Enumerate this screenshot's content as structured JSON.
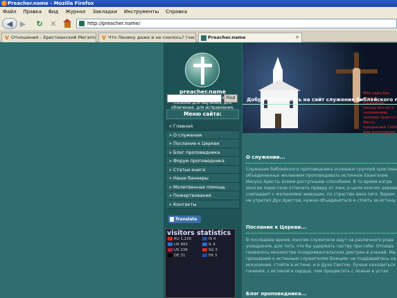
{
  "browser": {
    "title": "Preacher.name - Mozilla Firefox",
    "menu": [
      "Файл",
      "Правка",
      "Вид",
      "Журнал",
      "Закладки",
      "Инструменты",
      "Справка"
    ],
    "url": "http://preacher.name/",
    "tabs": [
      {
        "label": "Отношения - Христианский Мегапор...",
        "icon": "v-logo-icon"
      },
      {
        "label": "Что Ленину даже и не снилось? (час...",
        "icon": "v-logo-icon"
      },
      {
        "label": "Preacher.name",
        "icon": "site-icon",
        "active": true
      }
    ]
  },
  "site": {
    "name": "preacher.name",
    "motto": "Все Писание богодухновенно и полезно для научения, для обличения, для исправления, для наставления в праведности",
    "search_placeholder": "",
    "find_label": "Find",
    "menu_title": "Меню сайта:",
    "menu": [
      "« Главная",
      "» О служении",
      "» Послание к Церкви",
      "» Блог проповедника",
      "» Форум проповедника",
      "» Статьи книги",
      "» Наши баннеры",
      "» Молитвенная помощь",
      "» Пожертвования",
      "» Контакты"
    ],
    "translate_label": "Translate",
    "stats": {
      "title": "visitors statistics",
      "rows": [
        {
          "left": "RU 1,226",
          "left_color": "#d52b1e",
          "right": "IS 4",
          "right_color": "#1e4fa8"
        },
        {
          "left": "UA 882",
          "left_color": "#2b6fd5",
          "right": "IL 4",
          "right_color": "#2b6fd5"
        },
        {
          "left": "US 238",
          "left_color": "#b22234",
          "right": "SG 3",
          "right_color": "#d52b1e"
        },
        {
          "left": "DE 31",
          "left_color": "#000000",
          "right": "FR 3",
          "right_color": "#1e4fa8"
        }
      ]
    }
  },
  "banner": {
    "text": "Ибо един Бог, един и посредник между Богом и человеками, человек Христос Иисус, предавший Себя для искупления всех"
  },
  "main": {
    "welcome": "Добро пожаловать на сайт служения библейского проповедника",
    "sections": [
      {
        "title": "О служении...",
        "lines": [
          "Служение библейского проповедника основано группой христиан,",
          "объединенных желанием проповедовать истинное Евангелие",
          "Иисуса Христа, всеми доступными способами. В то время когда",
          "многие перестали отличать правду от лжи, и цели многих церквей",
          "совпадают с желаниями живущих, по страстям века сего. Верим,",
          "не утратил Дух Христов, нужно объединяться и стоять за истину."
        ]
      },
      {
        "title": "Послание к Церкви...",
        "lines": [
          "В последнее время, многие служители идут на различного рода",
          "ухищрения, для того, что бы удержать паству при себе. Отсюда",
          "появилось множество псевдоевангельских доктрин и учений. Мы",
          "призываем к истинным служителям Божьим: не поддавайтесь на",
          "искушение, стойте в истине, и в Духе Святом. Лучше находиться",
          "гонения, с истиной в сердце, чем процветать с ложью в устах."
        ]
      },
      {
        "title": "Блог проповедника...",
        "lines": []
      }
    ]
  }
}
